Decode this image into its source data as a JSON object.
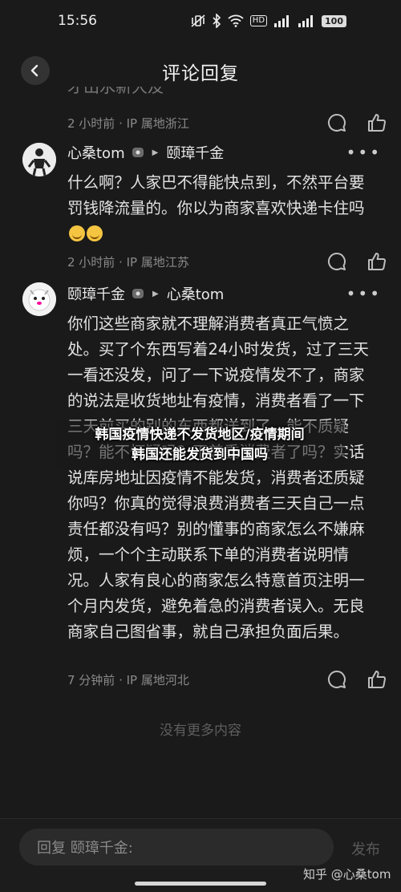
{
  "status_bar": {
    "time": "15:56",
    "icons": [
      "vibrate-off-icon",
      "bluetooth-icon",
      "wifi-icon",
      "hd-icon",
      "5g-signal-icon",
      "signal-icon"
    ],
    "hd_label": "HD",
    "battery": "100"
  },
  "header": {
    "title": "评论回复",
    "back_icon": "chevron-left-icon"
  },
  "previous_comment": {
    "clipped_text": "才山水新大及",
    "meta": "2 小时前 · IP 属地浙江"
  },
  "comments": [
    {
      "author": "心桑tom",
      "reply_to": "颐璋千金",
      "text": "什么啊？人家巴不得能快点到，不然平台要罚钱降流量的。你以为商家喜欢快递卡住吗",
      "emoji_count": 2,
      "meta": "2 小时前 · IP 属地江苏"
    },
    {
      "author": "颐璋千金",
      "reply_to": "心桑tom",
      "text": "你们这些商家就不理解消费者真正气愤之处。买了个东西写着24小时发货，过了三天一看还没发，问了一下说疫情发不了，商家的说法是收货地址有疫情，消费者看了一下三天前买的别的东西都送到了，能不质疑吗？能不怀疑吗？不尊重消费者了吗？实话说库房地址因疫情不能发货，消费者还质疑你吗？你真的觉得浪费消费者三天自己一点责任都没有吗？别的懂事的商家怎么不嫌麻烦，一个个主动联系下单的消费者说明情况。人家有良心的商家怎么特意首页注明一个月内发货，避免着急的消费者误入。无良商家自己图省事，就自己承担负面后果。",
      "meta": "7 分钟前 · IP 属地河北"
    }
  ],
  "overlay": {
    "line1": "韩国疫情快递不发货地区/疫情期间",
    "line2": "韩国还能发货到中国吗"
  },
  "footer_note": "没有更多内容",
  "reply_bar": {
    "placeholder": "回复 颐璋千金:",
    "send_label": "发布"
  },
  "watermark": "知乎 @心桑tom",
  "colors": {
    "background": "#1a1a1a",
    "text": "#e2e2e2",
    "muted": "#8a8a8a"
  }
}
